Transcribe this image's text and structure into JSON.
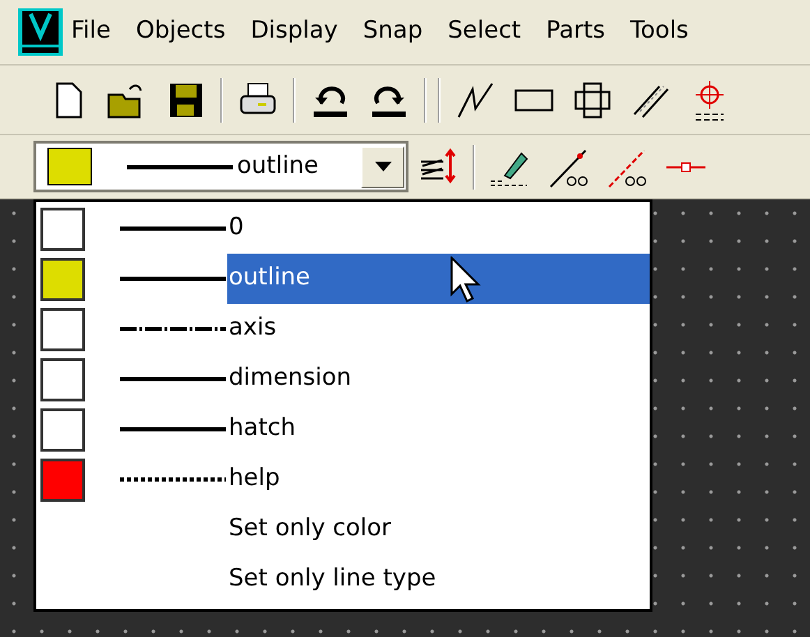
{
  "menu_bar": {
    "items": [
      "File",
      "Objects",
      "Display",
      "Snap",
      "Select",
      "Parts",
      "Tools"
    ]
  },
  "layer_combo": {
    "color": "#dddd00",
    "kind": "solid",
    "value": "outline"
  },
  "layer_list": {
    "items": [
      {
        "kind": "solid",
        "label": "0",
        "color": "#ffffff",
        "selected": false
      },
      {
        "kind": "solid",
        "label": "outline",
        "color": "#dddd00",
        "selected": true
      },
      {
        "kind": "dashdot",
        "label": "axis",
        "color": "#ffffff",
        "selected": false
      },
      {
        "kind": "solid",
        "label": "dimension",
        "color": "#ffffff",
        "selected": false
      },
      {
        "kind": "solid",
        "label": "hatch",
        "color": "#ffffff",
        "selected": false
      },
      {
        "kind": "dotted",
        "label": "help",
        "color": "#ff0000",
        "selected": false
      },
      {
        "kind": "action",
        "label": "Set only color",
        "selected": false
      },
      {
        "kind": "action",
        "label": "Set only line type",
        "selected": false
      }
    ]
  }
}
